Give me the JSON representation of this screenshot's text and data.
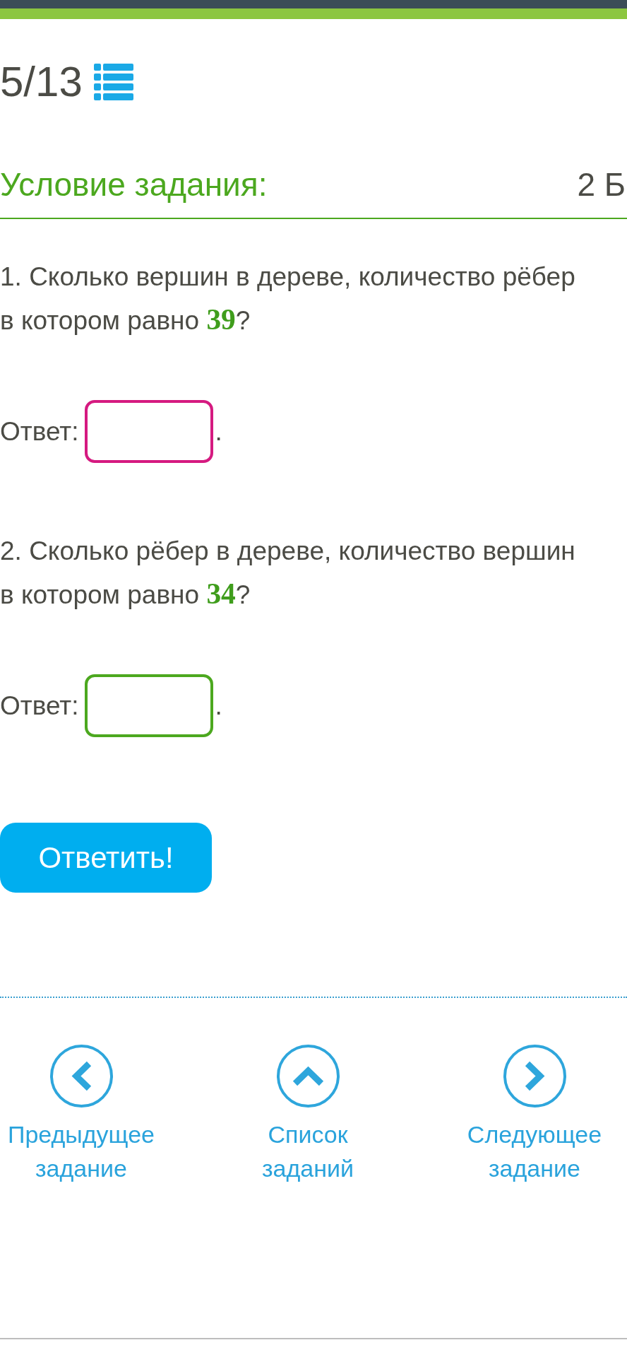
{
  "task_counter": "5/13",
  "task": {
    "heading": "Условие задания:",
    "points": "2 Б"
  },
  "questions": [
    {
      "text": "1. Сколько вершин в дереве, количество рёбер в котором равно **39**?",
      "answer_label": "Ответ:",
      "answer_field": {
        "focused": true
      },
      "after_field": "."
    },
    {
      "text": "2. Сколько рёбер в дереве, количество вершин в котором равно **34**?",
      "answer_label": "Ответ:",
      "answer_field": {
        "focused": false
      },
      "after_field": "."
    }
  ],
  "submit_button": "Ответить!",
  "navigation": [
    {
      "kind": "previous",
      "label": "Предыдущее задание"
    },
    {
      "kind": "list",
      "label": "Список заданий"
    },
    {
      "kind": "next",
      "label": "Следующее задание"
    }
  ]
}
